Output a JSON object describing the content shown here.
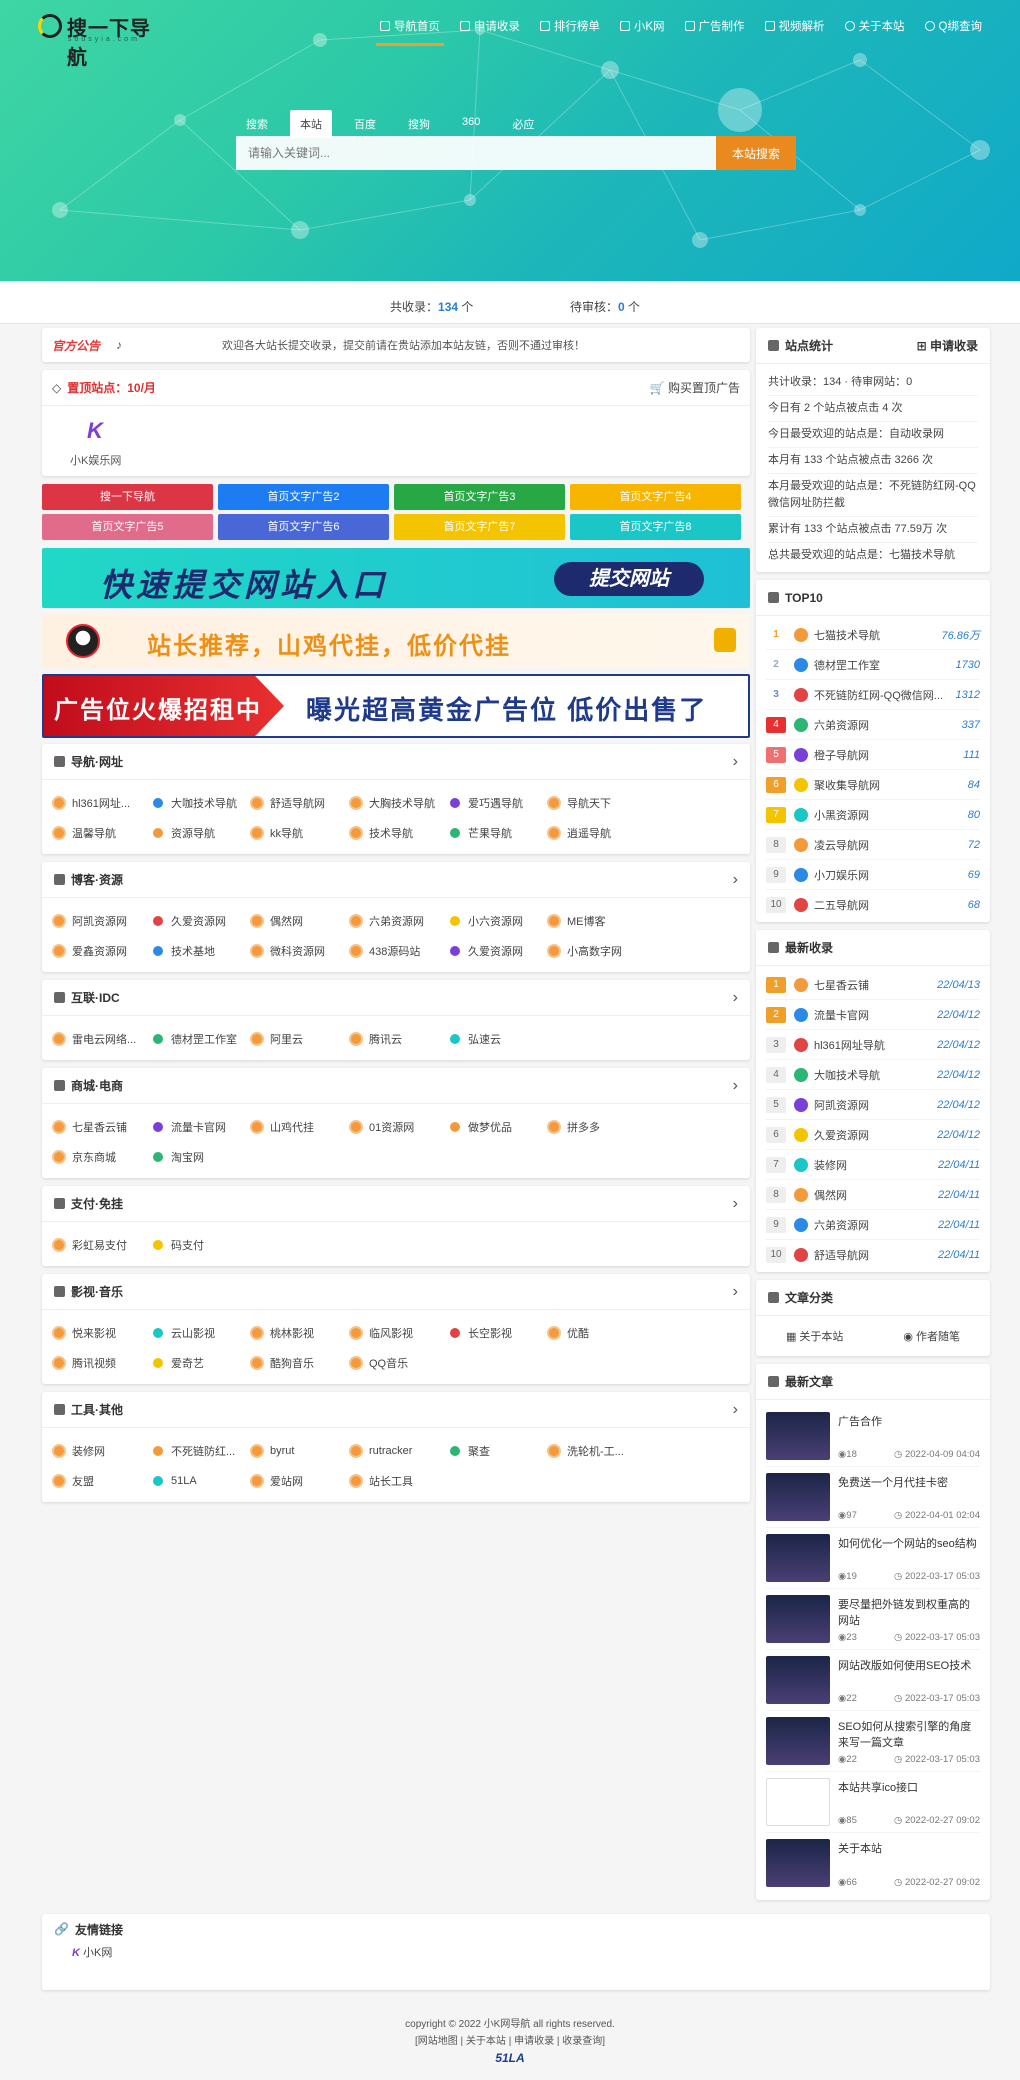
{
  "header": {
    "logo_text": "搜一下导航",
    "logo_sub": "sousyia.com",
    "nav": [
      "导航首页",
      "申请收录",
      "排行榜单",
      "小K网",
      "广告制作",
      "视频解析",
      "关于本站",
      "Q绑查询"
    ],
    "search_tabs": [
      "搜索",
      "本站",
      "百度",
      "搜狗",
      "360",
      "必应"
    ],
    "search_placeholder": "请输入关键词...",
    "search_button": "本站搜索"
  },
  "stats": {
    "total_label": "共收录：",
    "total": "134",
    "total_unit": " 个",
    "pending_label": "待审核：",
    "pending": "0",
    "pending_unit": " 个"
  },
  "notice": {
    "tag": "官方公告",
    "text": "欢迎各大站长提交收录，提交前请在贵站添加本站友链，否则不通过审核！"
  },
  "pinned": {
    "title": "置顶站点：10/月",
    "buy": "购买置顶广告",
    "site": "小K娱乐网"
  },
  "ads": [
    {
      "t": "搜一下导航",
      "c": "#dc3545"
    },
    {
      "t": "首页文字广告2",
      "c": "#1e7cf2"
    },
    {
      "t": "首页文字广告3",
      "c": "#28a745"
    },
    {
      "t": "首页文字广告4",
      "c": "#f7b500"
    },
    {
      "t": "首页文字广告5",
      "c": "#e06b8b"
    },
    {
      "t": "首页文字广告6",
      "c": "#4a67d8"
    },
    {
      "t": "首页文字广告7",
      "c": "#f4c400"
    },
    {
      "t": "首页文字广告8",
      "c": "#1bc6c6"
    }
  ],
  "banners": {
    "b1": "快速提交网站入口",
    "b1_btn": "提交网站",
    "b2": "站长推荐，山鸡代挂，低价代挂",
    "b3_l": "广告位火爆招租中",
    "b3_r": "曝光超高黄金广告位 低价出售了"
  },
  "categories": [
    {
      "name": "导航·网址",
      "items": [
        "hl361网址...",
        "大咖技术导航",
        "舒适导航网",
        "大胸技术导航",
        "爱巧遇导航",
        "导航天下",
        "温馨导航",
        "资源导航",
        "kk导航",
        "技术导航",
        "芒果导航",
        "逍遥导航"
      ]
    },
    {
      "name": "博客·资源",
      "items": [
        "阿凯资源网",
        "久爱资源网",
        "偶然网",
        "六弟资源网",
        "小六资源网",
        "ME博客",
        "爱鑫资源网",
        "技术基地",
        "微科资源网",
        "438源码站",
        "久爱资源网",
        "小高数字网"
      ]
    },
    {
      "name": "互联·IDC",
      "items": [
        "雷电云网络...",
        "德材罡工作室",
        "阿里云",
        "腾讯云",
        "弘速云"
      ]
    },
    {
      "name": "商城·电商",
      "items": [
        "七星香云铺",
        "流量卡官网",
        "山鸡代挂",
        "01资源网",
        "做梦优品",
        "拼多多",
        "京东商城",
        "淘宝网"
      ]
    },
    {
      "name": "支付·免挂",
      "items": [
        "彩虹易支付",
        "码支付"
      ]
    },
    {
      "name": "影视·音乐",
      "items": [
        "悦来影视",
        "云山影视",
        "桃林影视",
        "临风影视",
        "长空影视",
        "优酷",
        "腾讯视频",
        "爱奇艺",
        "酷狗音乐",
        "QQ音乐"
      ]
    },
    {
      "name": "工具·其他",
      "items": [
        "装修网",
        "不死链防红...",
        "byrut",
        "rutracker",
        "聚查",
        "洗轮机-工...",
        "友盟",
        "51LA",
        "爱站网",
        "站长工具"
      ]
    }
  ],
  "site_stats": {
    "title": "站点统计",
    "apply": "申请收录",
    "lines": [
      "共计收录：134 · 待审网站：0",
      "今日有 2 个站点被点击 4 次",
      "今日最受欢迎的站点是：自动收录网",
      "本月有 133 个站点被点击 3266 次",
      "本月最受欢迎的站点是：不死链防红网-QQ微信网址防拦截",
      "累计有 133 个站点被点击 77.59万 次",
      "总共最受欢迎的站点是：七猫技术导航"
    ]
  },
  "top10": {
    "title": "TOP10",
    "rows": [
      [
        "1",
        "七猫技术导航",
        "76.86万"
      ],
      [
        "2",
        "德材罡工作室",
        "1730"
      ],
      [
        "3",
        "不死链防红网-QQ微信网...",
        "1312"
      ],
      [
        "4",
        "六弟资源网",
        "337"
      ],
      [
        "5",
        "橙子导航网",
        "111"
      ],
      [
        "6",
        "聚收集导航网",
        "84"
      ],
      [
        "7",
        "小黑资源网",
        "80"
      ],
      [
        "8",
        "凌云导航网",
        "72"
      ],
      [
        "9",
        "小刀娱乐网",
        "69"
      ],
      [
        "10",
        "二五导航网",
        "68"
      ]
    ]
  },
  "latest": {
    "title": "最新收录",
    "rows": [
      [
        "1",
        "七星香云铺",
        "22/04/13"
      ],
      [
        "2",
        "流量卡官网",
        "22/04/12"
      ],
      [
        "3",
        "hl361网址导航",
        "22/04/12"
      ],
      [
        "4",
        "大咖技术导航",
        "22/04/12"
      ],
      [
        "5",
        "阿凯资源网",
        "22/04/12"
      ],
      [
        "6",
        "久爱资源网",
        "22/04/12"
      ],
      [
        "7",
        "装修网",
        "22/04/11"
      ],
      [
        "8",
        "偶然网",
        "22/04/11"
      ],
      [
        "9",
        "六弟资源网",
        "22/04/11"
      ],
      [
        "10",
        "舒适导航网",
        "22/04/11"
      ]
    ]
  },
  "article_cat": {
    "title": "文章分类",
    "items": [
      "关于本站",
      "作者随笔"
    ]
  },
  "articles": {
    "title": "最新文章",
    "rows": [
      [
        "广告合作",
        "18",
        "2022-04-09 04:04"
      ],
      [
        "免费送一个月代挂卡密",
        "97",
        "2022-04-01 02:04"
      ],
      [
        "如何优化一个网站的seo结构",
        "19",
        "2022-03-17 05:03"
      ],
      [
        "要尽量把外链发到权重高的网站",
        "23",
        "2022-03-17 05:03"
      ],
      [
        "网站改版如何使用SEO技术",
        "22",
        "2022-03-17 05:03"
      ],
      [
        "SEO如何从搜索引擎的角度来写一篇文章",
        "22",
        "2022-03-17 05:03"
      ],
      [
        "本站共享ico接口",
        "85",
        "2022-02-27 09:02"
      ],
      [
        "关于本站",
        "66",
        "2022-02-27 09:02"
      ]
    ]
  },
  "friend": {
    "title": "友情链接",
    "items": [
      "小K网"
    ]
  },
  "footer": {
    "copy": "copyright © 2022 小K网导航 all rights reserved.",
    "links": "[网站地图 | 关于本站 | 申请收录 | 收录查询]",
    "la": "51LA"
  }
}
